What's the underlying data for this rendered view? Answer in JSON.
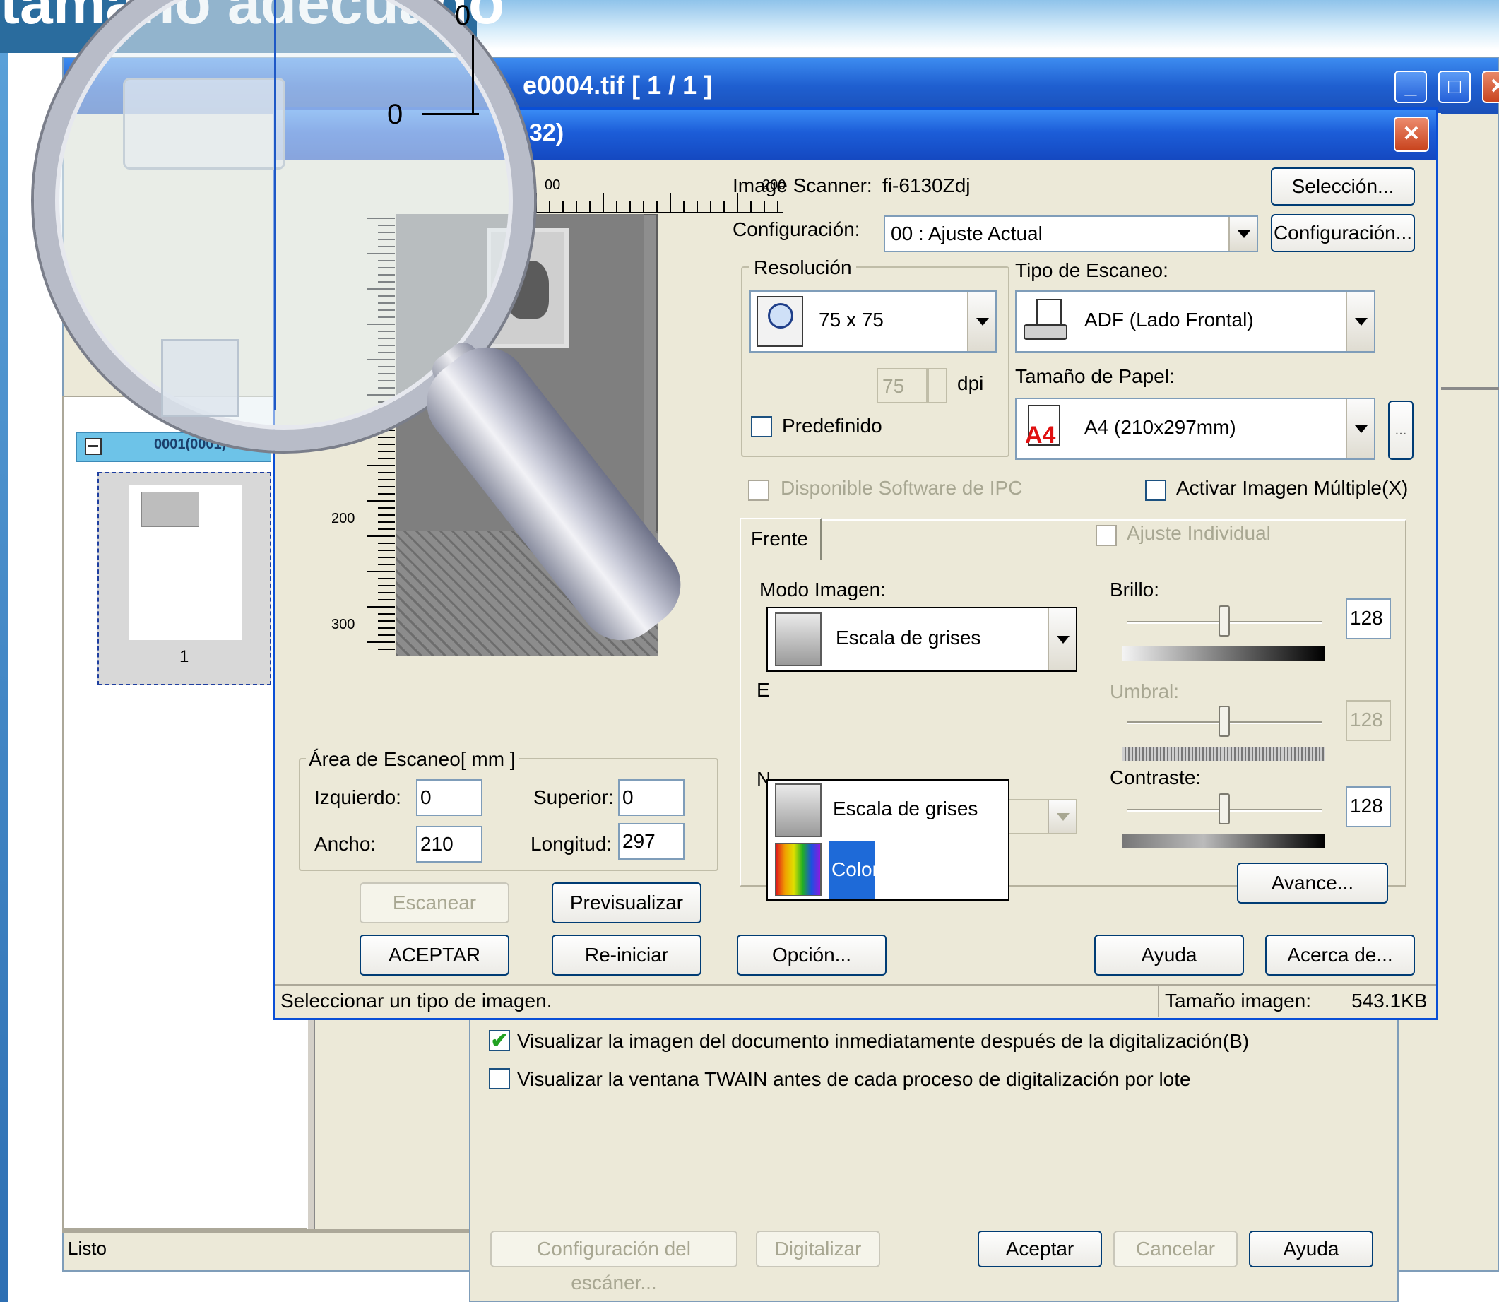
{
  "banner": {
    "text": "tamaño adecuado"
  },
  "app": {
    "title": "e0004.tif  [ 1 / 1 ]",
    "min_glyph": "_",
    "max_glyph": "□",
    "close_glyph": "✕",
    "toolbar_icon_label": "100",
    "status": "Listo"
  },
  "thumbs": {
    "header": "0001(0001)",
    "page_number": "1"
  },
  "magnifier": {
    "ruler_top": "0",
    "ruler_left": "0"
  },
  "dialog": {
    "title": "32)",
    "close_glyph": "✕",
    "ruler": {
      "top_labels": [
        "00",
        "200"
      ],
      "left_labels": [
        "200",
        "300"
      ]
    },
    "scanner": {
      "label": "Image Scanner:",
      "value": "fi-6130Zdj",
      "select_button": "Selección..."
    },
    "config": {
      "label": "Configuración:",
      "value": "00 : Ajuste Actual",
      "button": "Configuración..."
    },
    "resolution": {
      "group_label": "Resolución",
      "value": "75 x 75",
      "dpi_value": "75",
      "dpi_unit": "dpi",
      "predefined": "Predefinido"
    },
    "scan_type": {
      "label": "Tipo de Escaneo:",
      "value": "ADF (Lado Frontal)"
    },
    "paper_size": {
      "label": "Tamaño de Papel:",
      "value": "A4 (210x297mm)",
      "icon_text": "A4",
      "more_button": "..."
    },
    "ipc": {
      "label": "Disponible  Software de IPC"
    },
    "multi_image": {
      "label": "Activar Imagen Múltiple(X)"
    },
    "tab": {
      "label": "Frente"
    },
    "individual": {
      "label": "Ajuste Individual"
    },
    "image_mode": {
      "label": "Modo Imagen:",
      "value": "Escala de grises",
      "options": [
        "Escala de grises",
        "Color"
      ],
      "selected_index": 1,
      "hidden_label_1": "E",
      "hidden_label_2": "N"
    },
    "brightness": {
      "label": "Brillo:",
      "value": "128",
      "level": 0.5
    },
    "threshold": {
      "label": "Umbral:",
      "value": "128",
      "level": 0.5
    },
    "contrast": {
      "label": "Contraste:",
      "value": "128",
      "level": 0.5
    },
    "advanced_button": "Avance...",
    "scan_area": {
      "title": "Área de Escaneo[ mm ]",
      "left_label": "Izquierdo:",
      "left_value": "0",
      "top_label": "Superior:",
      "top_value": "0",
      "width_label": "Ancho:",
      "width_value": "210",
      "length_label": "Longitud:",
      "length_value": "297"
    },
    "buttons": {
      "scan": "Escanear",
      "preview": "Previsualizar",
      "accept": "ACEPTAR",
      "reset": "Re-iniciar",
      "option": "Opción...",
      "help": "Ayuda",
      "about": "Acerca de..."
    },
    "statusbar": {
      "hint": "Seleccionar un tipo de imagen.",
      "size_label": "Tamaño imagen:",
      "size_value": "543.1KB"
    }
  },
  "options_dialog": {
    "check1": {
      "label": "Visualizar la imagen del documento inmediatamente después de la digitalización(B)",
      "checked": true
    },
    "check2": {
      "label": "Visualizar la ventana TWAIN antes de cada proceso de digitalización por lote",
      "checked": false
    },
    "check_mark": "✔",
    "buttons": {
      "scanner_config": "Configuración del escáner...",
      "digitize": "Digitalizar",
      "accept": "Aceptar",
      "cancel": "Cancelar",
      "help": "Ayuda"
    }
  }
}
